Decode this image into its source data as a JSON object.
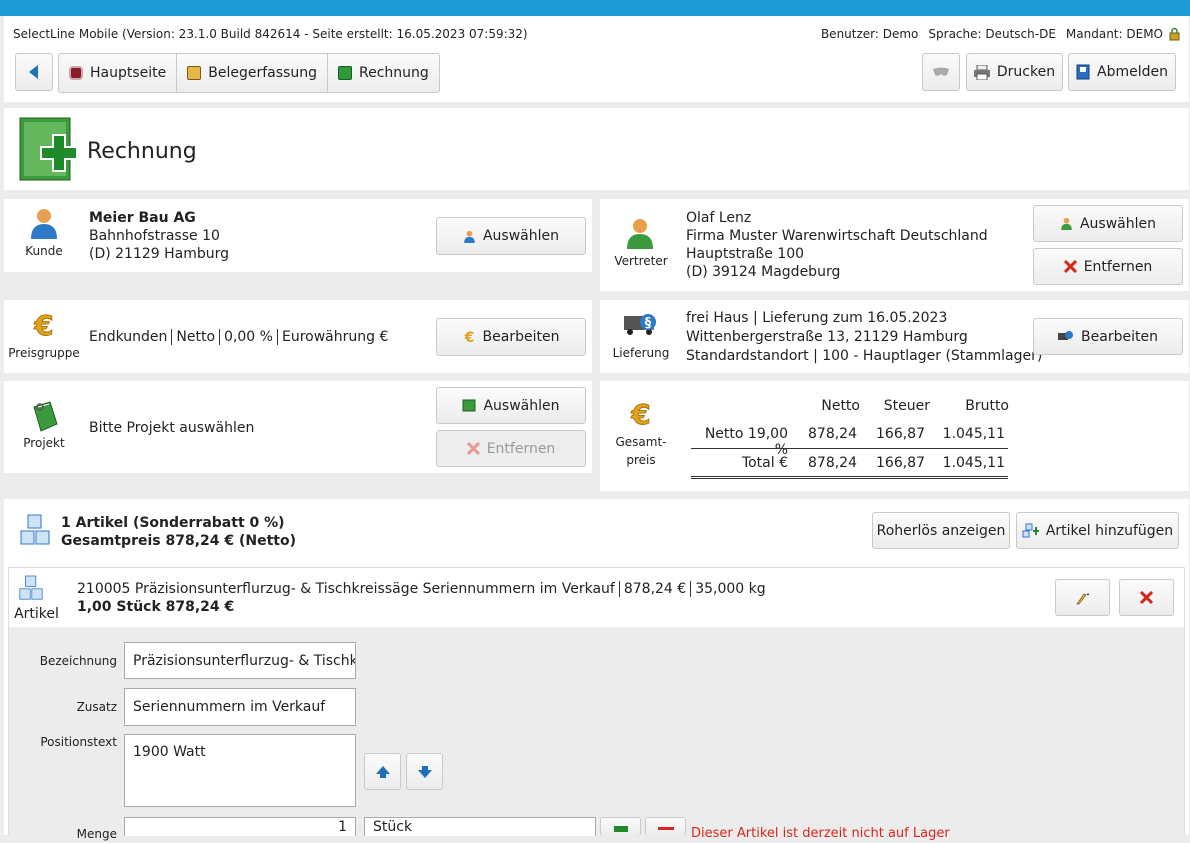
{
  "header": {
    "version_text": "SelectLine Mobile (Version: 23.1.0 Build 842614 - Seite erstellt: 16.05.2023 07:59:32)",
    "user": "Benutzer: Demo",
    "language": "Sprache: Deutsch-DE",
    "client": "Mandant: DEMO"
  },
  "nav": {
    "home": "Hauptseite",
    "capture": "Belegerfassung",
    "invoice": "Rechnung",
    "print": "Drucken",
    "logout": "Abmelden"
  },
  "page": {
    "title": "Rechnung"
  },
  "customer": {
    "caption": "Kunde",
    "name": "Meier Bau AG",
    "street": "Bahnhofstrasse 10",
    "city": "(D) 21129 Hamburg",
    "select_label": "Auswählen"
  },
  "rep": {
    "caption": "Vertreter",
    "name": "Olaf Lenz",
    "company": "Firma Muster Warenwirtschaft Deutschland",
    "street": "Hauptstraße 100",
    "city": "(D) 39124 Magdeburg",
    "select_label": "Auswählen",
    "remove_label": "Entfernen"
  },
  "pricegroup": {
    "caption": "Preisgruppe",
    "parts": [
      "Endkunden",
      "Netto",
      "0,00 %",
      "Eurowährung €"
    ],
    "edit_label": "Bearbeiten"
  },
  "delivery": {
    "caption": "Lieferung",
    "line1": "frei Haus | Lieferung zum 16.05.2023",
    "line2": "Wittenbergerstraße 13, 21129 Hamburg",
    "line3": "Standardstandort | 100 - Hauptlager (Stammlager)",
    "edit_label": "Bearbeiten"
  },
  "project": {
    "caption": "Projekt",
    "text": "Bitte Projekt auswählen",
    "select_label": "Auswählen",
    "remove_label": "Entfernen"
  },
  "totals": {
    "caption1": "Gesamt-",
    "caption2": "preis",
    "head_net": "Netto",
    "head_tax": "Steuer",
    "head_gross": "Brutto",
    "row1_label": "Netto 19,00 %",
    "row1_net": "878,24",
    "row1_tax": "166,87",
    "row1_gross": "1.045,11",
    "total_label": "Total €",
    "total_net": "878,24",
    "total_tax": "166,87",
    "total_gross": "1.045,11"
  },
  "articles": {
    "summary1": "1 Artikel (Sonderrabatt 0 %)",
    "summary2": "Gesamtpreis 878,24  € (Netto)",
    "margin_btn": "Roherlös anzeigen",
    "add_btn": "Artikel hinzufügen",
    "item_caption": "Artikel",
    "item_line1_a": "210005 Präzisionsunterflurzug- & Tischkreissäge Seriennummern im Verkauf",
    "item_line1_b": "878,24  €",
    "item_line1_c": "35,000 kg",
    "item_line2": "1,00 Stück 878,24  €"
  },
  "form": {
    "desc_label": "Bezeichnung",
    "desc_value": "Präzisionsunterflurzug- & Tischkreissäge",
    "extra_label": "Zusatz",
    "extra_value": "Seriennummern im Verkauf",
    "postext_label": "Positionstext",
    "postext_value": "1900 Watt",
    "qty_label": "Menge",
    "qty_value": "1",
    "unit_value": "Stück",
    "warning": "Dieser Artikel ist derzeit nicht auf Lager"
  },
  "colors": {
    "accent": "#1e9ad6",
    "danger": "#d9261c",
    "warning_text": "#d9261c"
  }
}
